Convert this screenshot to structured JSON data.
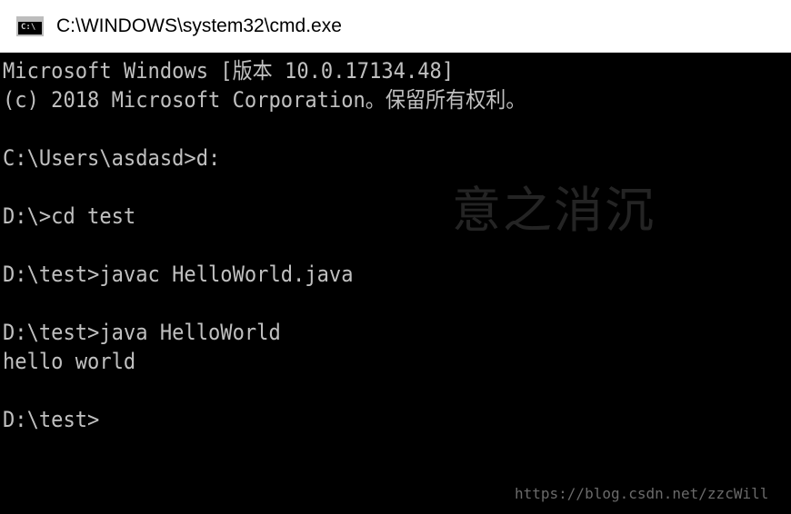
{
  "window": {
    "title": "C:\\WINDOWS\\system32\\cmd.exe",
    "icon": "cmd-prompt-icon",
    "icon_glyph": "C:\\"
  },
  "console": {
    "lines": [
      "Microsoft Windows [版本 10.0.17134.48]",
      "(c) 2018 Microsoft Corporation。保留所有权利。",
      "",
      "C:\\Users\\asdasd>d:",
      "",
      "D:\\>cd test",
      "",
      "D:\\test>javac HelloWorld.java",
      "",
      "D:\\test>java HelloWorld",
      "hello world",
      "",
      "D:\\test>"
    ]
  },
  "watermarks": {
    "overlay_text": "意之消沉",
    "source_url": "https://blog.csdn.net/zzcWill"
  },
  "colors": {
    "console_background": "#000000",
    "console_text": "#c0c0c0",
    "titlebar_background": "#ffffff",
    "title_text": "#000000"
  }
}
